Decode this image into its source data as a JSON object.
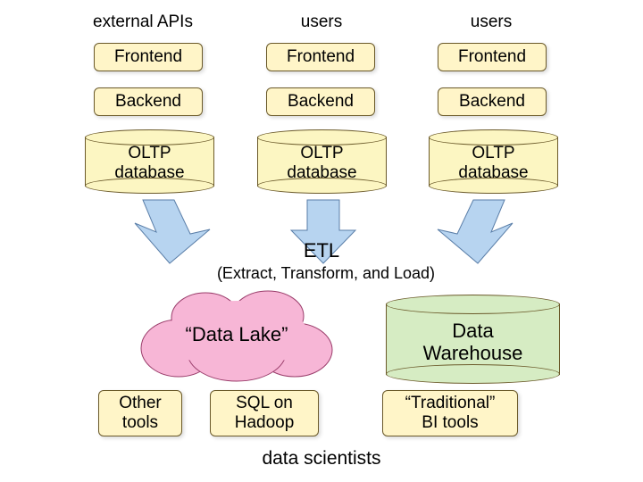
{
  "columns": {
    "headers": [
      "external APIs",
      "users",
      "users"
    ],
    "frontend": [
      "Frontend",
      "Frontend",
      "Frontend"
    ],
    "backend": [
      "Backend",
      "Backend",
      "Backend"
    ],
    "oltp": [
      "OLTP\ndatabase",
      "OLTP\ndatabase",
      "OLTP\ndatabase"
    ]
  },
  "etl": {
    "title": "ETL",
    "subtitle": "(Extract, Transform, and Load)"
  },
  "lake_label": "“Data Lake”",
  "warehouse_label": "Data\nWarehouse",
  "tools": {
    "other": "Other\ntools",
    "sql_hadoop": "SQL on\nHadoop",
    "bi": "“Traditional”\nBI tools"
  },
  "footer": "data scientists"
}
